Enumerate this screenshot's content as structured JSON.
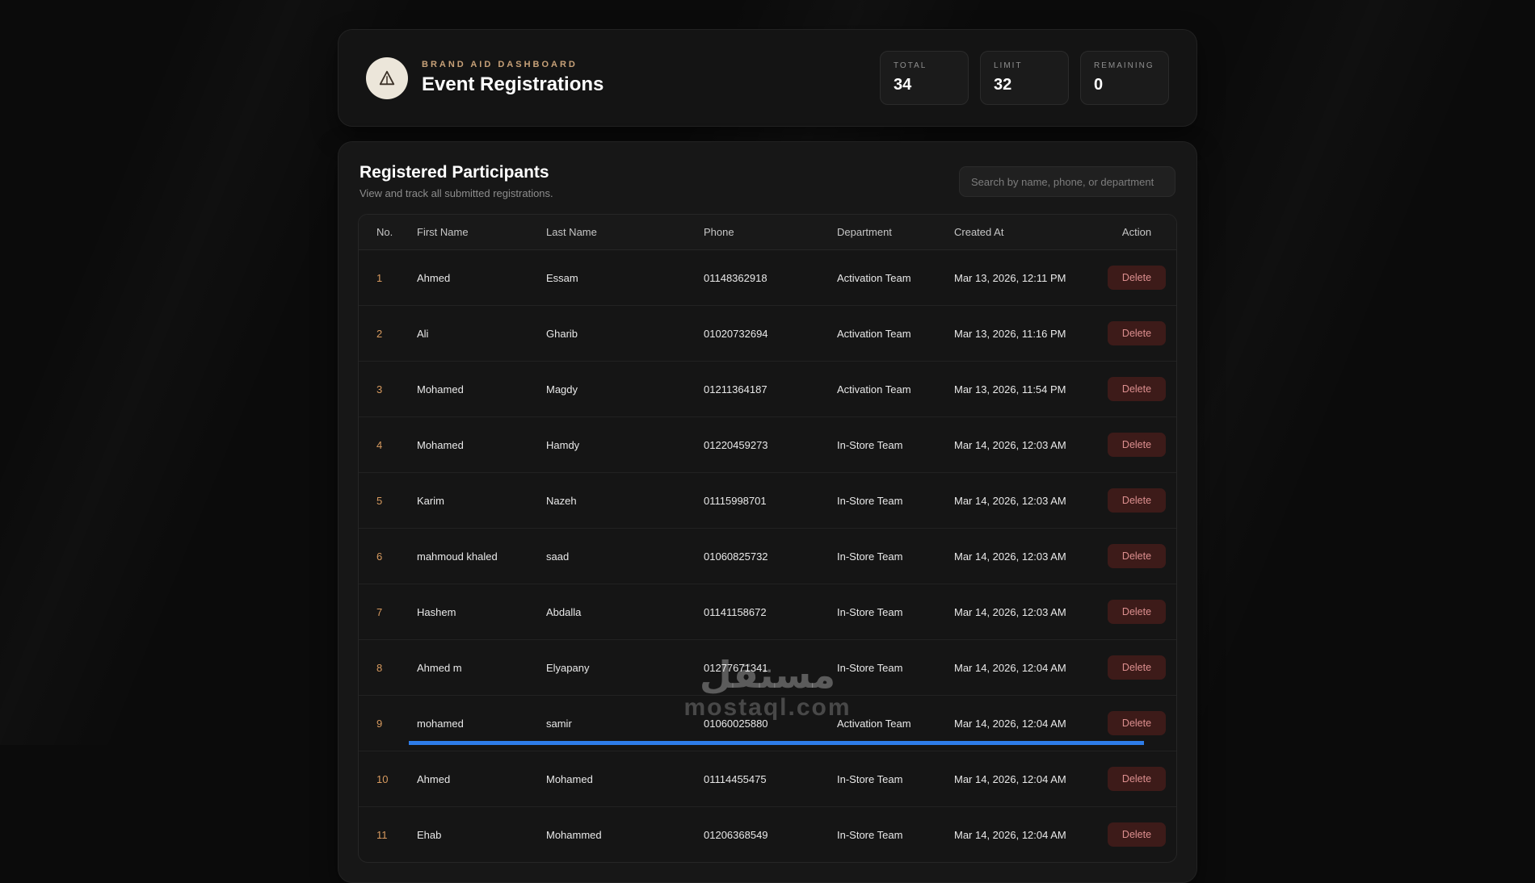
{
  "header": {
    "brand": "BRAND AID DASHBOARD",
    "title": "Event Registrations",
    "stats": [
      {
        "label": "TOTAL",
        "value": "34"
      },
      {
        "label": "LIMIT",
        "value": "32"
      },
      {
        "label": "REMAINING",
        "value": "0"
      }
    ]
  },
  "participants": {
    "title": "Registered Participants",
    "subtitle": "View and track all submitted registrations.",
    "search_placeholder": "Search by name, phone, or department",
    "columns": [
      "No.",
      "First Name",
      "Last Name",
      "Phone",
      "Department",
      "Created At",
      "Action"
    ],
    "delete_label": "Delete",
    "rows": [
      {
        "no": "1",
        "first": "Ahmed",
        "last": "Essam",
        "phone": "01148362918",
        "department": "Activation Team",
        "created": "Mar 13, 2026, 12:11 PM"
      },
      {
        "no": "2",
        "first": "Ali",
        "last": "Gharib",
        "phone": "01020732694",
        "department": "Activation Team",
        "created": "Mar 13, 2026, 11:16 PM"
      },
      {
        "no": "3",
        "first": "Mohamed",
        "last": "Magdy",
        "phone": "01211364187",
        "department": "Activation Team",
        "created": "Mar 13, 2026, 11:54 PM"
      },
      {
        "no": "4",
        "first": "Mohamed",
        "last": "Hamdy",
        "phone": "01220459273",
        "department": "In-Store Team",
        "created": "Mar 14, 2026, 12:03 AM"
      },
      {
        "no": "5",
        "first": "Karim",
        "last": "Nazeh",
        "phone": "01115998701",
        "department": "In-Store Team",
        "created": "Mar 14, 2026, 12:03 AM"
      },
      {
        "no": "6",
        "first": "mahmoud khaled",
        "last": "saad",
        "phone": "01060825732",
        "department": "In-Store Team",
        "created": "Mar 14, 2026, 12:03 AM"
      },
      {
        "no": "7",
        "first": "Hashem",
        "last": "Abdalla",
        "phone": "01141158672",
        "department": "In-Store Team",
        "created": "Mar 14, 2026, 12:03 AM"
      },
      {
        "no": "8",
        "first": "Ahmed m",
        "last": "Elyapany",
        "phone": "01277671341",
        "department": "In-Store Team",
        "created": "Mar 14, 2026, 12:04 AM"
      },
      {
        "no": "9",
        "first": "mohamed",
        "last": "samir",
        "phone": "01060025880",
        "department": "Activation Team",
        "created": "Mar 14, 2026, 12:04 AM"
      },
      {
        "no": "10",
        "first": "Ahmed",
        "last": "Mohamed",
        "phone": "01114455475",
        "department": "In-Store Team",
        "created": "Mar 14, 2026, 12:04 AM"
      },
      {
        "no": "11",
        "first": "Ehab",
        "last": "Mohammed",
        "phone": "01206368549",
        "department": "In-Store Team",
        "created": "Mar 14, 2026, 12:04 AM"
      }
    ]
  },
  "watermark": {
    "arabic": "مستقل",
    "domain": "mostaql.com"
  },
  "colors": {
    "accent_amber": "#c7a178",
    "row_number": "#d79a5f",
    "delete_bg": "#3d1b19",
    "delete_text": "#dd8f8f",
    "progress_blue": "#2e7de9",
    "logo_circle_bg": "#ece6da"
  }
}
